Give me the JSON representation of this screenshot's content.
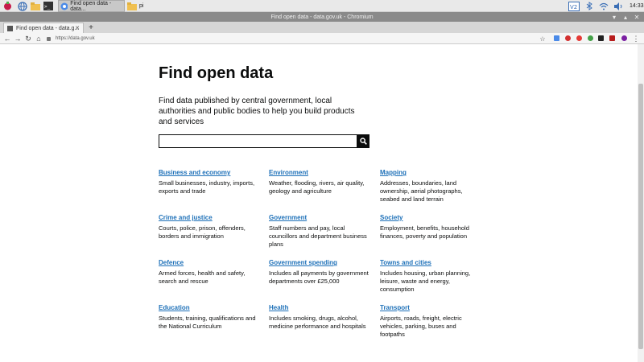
{
  "taskbar": {
    "tasks": [
      {
        "label": "Find open data - data..."
      },
      {
        "label": "pi"
      }
    ],
    "clock": "14:33"
  },
  "window": {
    "title": "Find open data - data.gov.uk - Chromium"
  },
  "tab": {
    "title": "Find open data - data.g..."
  },
  "toolbar": {
    "url": "https://data.gov.uk"
  },
  "page": {
    "heading": "Find open data",
    "intro": "Find data published by central government, local authorities and public bodies to help you build products and services",
    "search_placeholder": ""
  },
  "topics": [
    {
      "title": "Business and economy",
      "desc": "Small businesses, industry, imports, exports and trade"
    },
    {
      "title": "Environment",
      "desc": "Weather, flooding, rivers, air quality, geology and agriculture"
    },
    {
      "title": "Mapping",
      "desc": "Addresses, boundaries, land ownership, aerial photographs, seabed and land terrain"
    },
    {
      "title": "Crime and justice",
      "desc": "Courts, police, prison, offenders, borders and immigration"
    },
    {
      "title": "Government",
      "desc": "Staff numbers and pay, local councillors and department business plans"
    },
    {
      "title": "Society",
      "desc": "Employment, benefits, household finances, poverty and population"
    },
    {
      "title": "Defence",
      "desc": "Armed forces, health and safety, search and rescue"
    },
    {
      "title": "Government spending",
      "desc": "Includes all payments by government departments over £25,000"
    },
    {
      "title": "Towns and cities",
      "desc": "Includes housing, urban planning, leisure, waste and energy, consumption"
    },
    {
      "title": "Education",
      "desc": "Students, training, qualifications and the National Curriculum"
    },
    {
      "title": "Health",
      "desc": "Includes smoking, drugs, alcohol, medicine performance and hospitals"
    },
    {
      "title": "Transport",
      "desc": "Airports, roads, freight, electric vehicles, parking, buses and footpaths"
    }
  ],
  "colors": {
    "link": "#1d70b8",
    "text": "#0b0c0c"
  }
}
